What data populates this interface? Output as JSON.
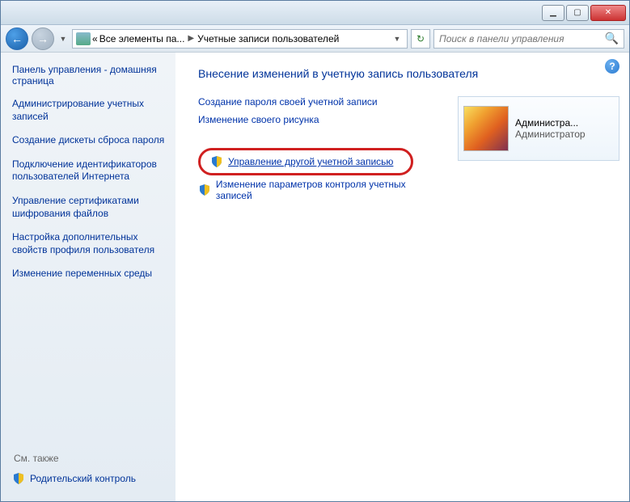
{
  "titlebar": {
    "min": "▁",
    "max": "▢",
    "close": "✕"
  },
  "nav": {
    "breadcrumb": {
      "prefix": "«",
      "seg1": "Все элементы па...",
      "seg2": "Учетные записи пользователей"
    },
    "search_placeholder": "Поиск в панели управления"
  },
  "sidebar": {
    "title": "Панель управления - домашняя страница",
    "links": [
      "Администрирование учетных записей",
      "Создание дискеты сброса пароля",
      "Подключение идентификаторов пользователей Интернета",
      "Управление сертификатами шифрования файлов",
      "Настройка дополнительных свойств профиля пользователя",
      "Изменение переменных среды"
    ],
    "see_also": "См. также",
    "parental": "Родительский контроль"
  },
  "main": {
    "heading": "Внесение изменений в учетную запись пользователя",
    "link_create_pw": "Создание пароля своей учетной записи",
    "link_change_pic": "Изменение своего рисунка",
    "link_manage_other": "Управление другой учетной записью",
    "link_uac": "Изменение параметров контроля учетных записей",
    "user": {
      "name": "Администра...",
      "role": "Администратор"
    }
  }
}
